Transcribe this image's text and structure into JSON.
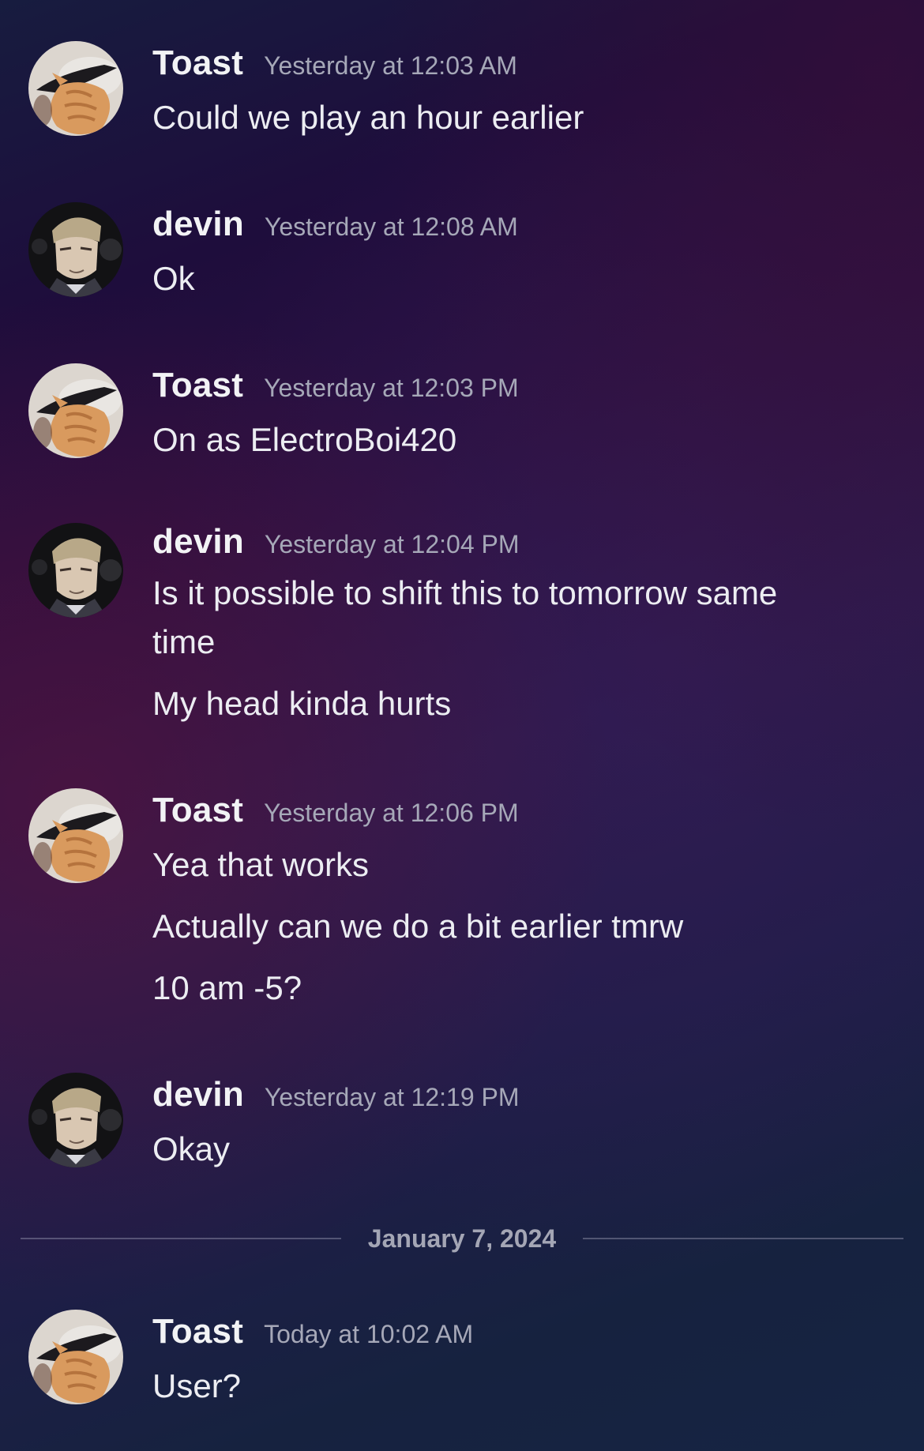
{
  "messages": [
    {
      "author": "Toast",
      "timestamp": "Yesterday at 12:03 AM",
      "avatar_icon": "cat-avatar-icon",
      "lines": [
        "Could we play an hour earlier"
      ]
    },
    {
      "author": "devin",
      "timestamp": "Yesterday at 12:08 AM",
      "avatar_icon": "anime-man-avatar-icon",
      "lines": [
        "Ok"
      ]
    },
    {
      "author": "Toast",
      "timestamp": "Yesterday at 12:03 PM",
      "avatar_icon": "cat-avatar-icon",
      "lines": [
        "On as ElectroBoi420"
      ]
    },
    {
      "author": "devin",
      "timestamp": "Yesterday at 12:04 PM",
      "avatar_icon": "anime-man-avatar-icon",
      "lines": [
        "Is it possible to shift this to tomorrow same",
        "time",
        "My head kinda hurts"
      ]
    },
    {
      "author": "Toast",
      "timestamp": "Yesterday at 12:06 PM",
      "avatar_icon": "cat-avatar-icon",
      "lines": [
        "Yea that works",
        "Actually can we do a bit earlier tmrw",
        "10 am -5?"
      ]
    },
    {
      "author": "devin",
      "timestamp": "Yesterday at 12:19 PM",
      "avatar_icon": "anime-man-avatar-icon",
      "lines": [
        "Okay"
      ]
    },
    {
      "author": "Toast",
      "timestamp": "Today at 10:02 AM",
      "avatar_icon": "cat-avatar-icon",
      "lines": [
        "User?"
      ]
    }
  ],
  "date_divider": {
    "label": "January 7, 2024"
  },
  "colors": {
    "author_text": "#f2f3f5",
    "timestamp_text": "#a6a8b8",
    "message_text": "#ecedf2",
    "divider_text": "#a4a6b5"
  }
}
